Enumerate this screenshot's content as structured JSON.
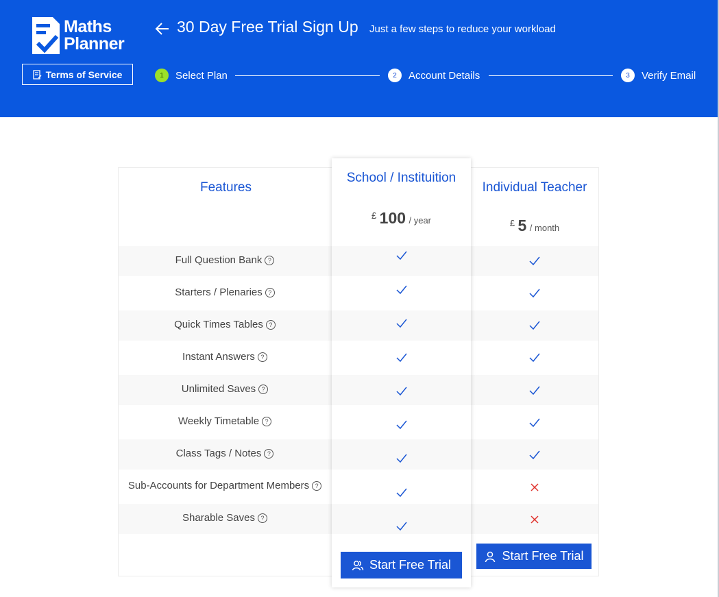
{
  "brand": {
    "line1": "Maths",
    "line2": "Planner"
  },
  "header": {
    "terms_label": "Terms of Service",
    "title": "30 Day Free Trial Sign Up",
    "subtitle": "Just a few steps to reduce your workload",
    "steps": [
      {
        "num": "1",
        "label": "Select Plan"
      },
      {
        "num": "2",
        "label": "Account Details"
      },
      {
        "num": "3",
        "label": "Verify Email"
      }
    ]
  },
  "table": {
    "features_heading": "Features",
    "plans": [
      {
        "name": "School / Instituition",
        "currency": "£",
        "amount": "100",
        "period": "/ year",
        "cta": "Start Free Trial"
      },
      {
        "name": "Individual Teacher",
        "currency": "£",
        "amount": "5",
        "period": "/ month",
        "cta": "Start Free Trial"
      }
    ],
    "features": [
      {
        "label": "Full Question Bank",
        "school": true,
        "individual": true
      },
      {
        "label": "Starters / Plenaries",
        "school": true,
        "individual": true
      },
      {
        "label": "Quick Times Tables",
        "school": true,
        "individual": true
      },
      {
        "label": "Instant Answers",
        "school": true,
        "individual": true
      },
      {
        "label": "Unlimited Saves",
        "school": true,
        "individual": true
      },
      {
        "label": "Weekly Timetable",
        "school": true,
        "individual": true
      },
      {
        "label": "Class Tags / Notes",
        "school": true,
        "individual": true
      },
      {
        "label": "Sub-Accounts for Department Members",
        "school": true,
        "individual": false
      },
      {
        "label": "Sharable Saves",
        "school": true,
        "individual": false
      }
    ]
  },
  "colors": {
    "header_bg": "#0a58e0",
    "accent": "#1a56d4",
    "check": "#1a56d4",
    "cross": "#e0342f",
    "active_step": "#9be02a"
  }
}
